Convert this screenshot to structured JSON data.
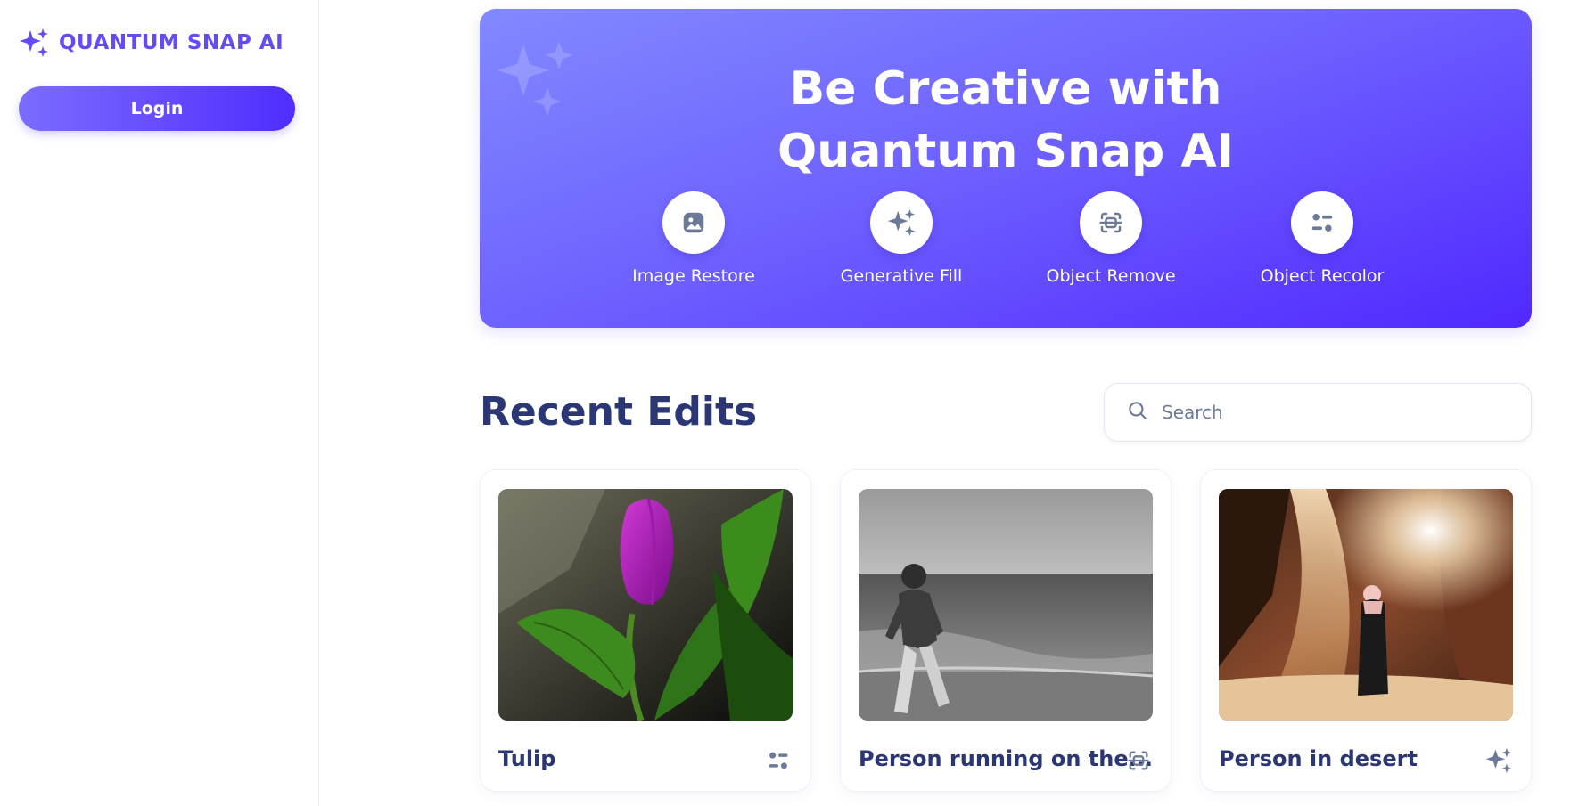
{
  "sidebar": {
    "logo_text": "QUANTUM SNAP AI",
    "login_label": "Login"
  },
  "hero": {
    "title_line1": "Be Creative with",
    "title_line2": "Quantum Snap AI",
    "tools": [
      {
        "label": "Image Restore",
        "icon": "image-icon"
      },
      {
        "label": "Generative Fill",
        "icon": "sparkles-icon"
      },
      {
        "label": "Object Remove",
        "icon": "scan-icon"
      },
      {
        "label": "Object Recolor",
        "icon": "filter-icon"
      }
    ]
  },
  "recent": {
    "title": "Recent Edits",
    "search_placeholder": "Search",
    "cards": [
      {
        "title": "Tulip",
        "icon": "filter-icon"
      },
      {
        "title": "Person running on the...",
        "icon": "scan-icon"
      },
      {
        "title": "Person in desert",
        "icon": "sparkles-icon"
      }
    ]
  },
  "colors": {
    "brand": "#624cf5",
    "hero_start": "#8189ff",
    "hero_end": "#5128ff",
    "heading": "#2b3674",
    "icon_gray": "#6b7a99"
  }
}
